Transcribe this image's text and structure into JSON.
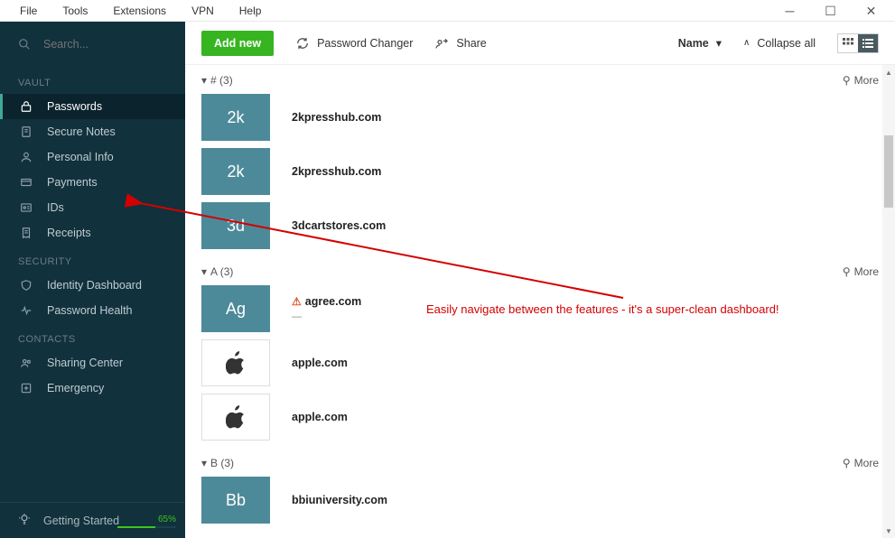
{
  "menubar": {
    "items": [
      "File",
      "Tools",
      "Extensions",
      "VPN",
      "Help"
    ]
  },
  "search": {
    "placeholder": "Search..."
  },
  "sidebar": {
    "sections": [
      {
        "title": "VAULT",
        "items": [
          {
            "label": "Passwords",
            "active": true
          },
          {
            "label": "Secure Notes"
          },
          {
            "label": "Personal Info"
          },
          {
            "label": "Payments"
          },
          {
            "label": "IDs"
          },
          {
            "label": "Receipts"
          }
        ]
      },
      {
        "title": "SECURITY",
        "items": [
          {
            "label": "Identity Dashboard"
          },
          {
            "label": "Password Health"
          }
        ]
      },
      {
        "title": "CONTACTS",
        "items": [
          {
            "label": "Sharing Center"
          },
          {
            "label": "Emergency"
          }
        ]
      }
    ],
    "getting_started": {
      "label": "Getting Started",
      "percent": "65%",
      "progress": 65
    }
  },
  "toolbar": {
    "add_label": "Add new",
    "password_changer": "Password Changer",
    "share": "Share",
    "sort_label": "Name",
    "collapse_label": "Collapse all"
  },
  "groups": [
    {
      "header": "# (3)",
      "more": "More",
      "entries": [
        {
          "tile": "2k",
          "title": "2kpresshub.com",
          "style": "filled"
        },
        {
          "tile": "2k",
          "title": "2kpresshub.com",
          "style": "filled"
        },
        {
          "tile": "3d",
          "title": "3dcartstores.com",
          "style": "filled"
        }
      ]
    },
    {
      "header": "A (3)",
      "more": "More",
      "entries": [
        {
          "tile": "Ag",
          "title": "agree.com",
          "style": "filled",
          "warn": true,
          "sub": "—"
        },
        {
          "tile": "apple",
          "title": "apple.com",
          "style": "outline"
        },
        {
          "tile": "apple",
          "title": "apple.com",
          "style": "outline"
        }
      ]
    },
    {
      "header": "B (3)",
      "more": "More",
      "entries": [
        {
          "tile": "Bb",
          "title": "bbiuniversity.com",
          "style": "filled"
        }
      ]
    }
  ],
  "annotation": {
    "text": "Easily navigate between the features - it's a super-clean dashboard!"
  },
  "colors": {
    "sidebar_bg": "#11313d",
    "accent_green": "#36b521",
    "tile_teal": "#4d8a99",
    "annot_red": "#d40000"
  }
}
